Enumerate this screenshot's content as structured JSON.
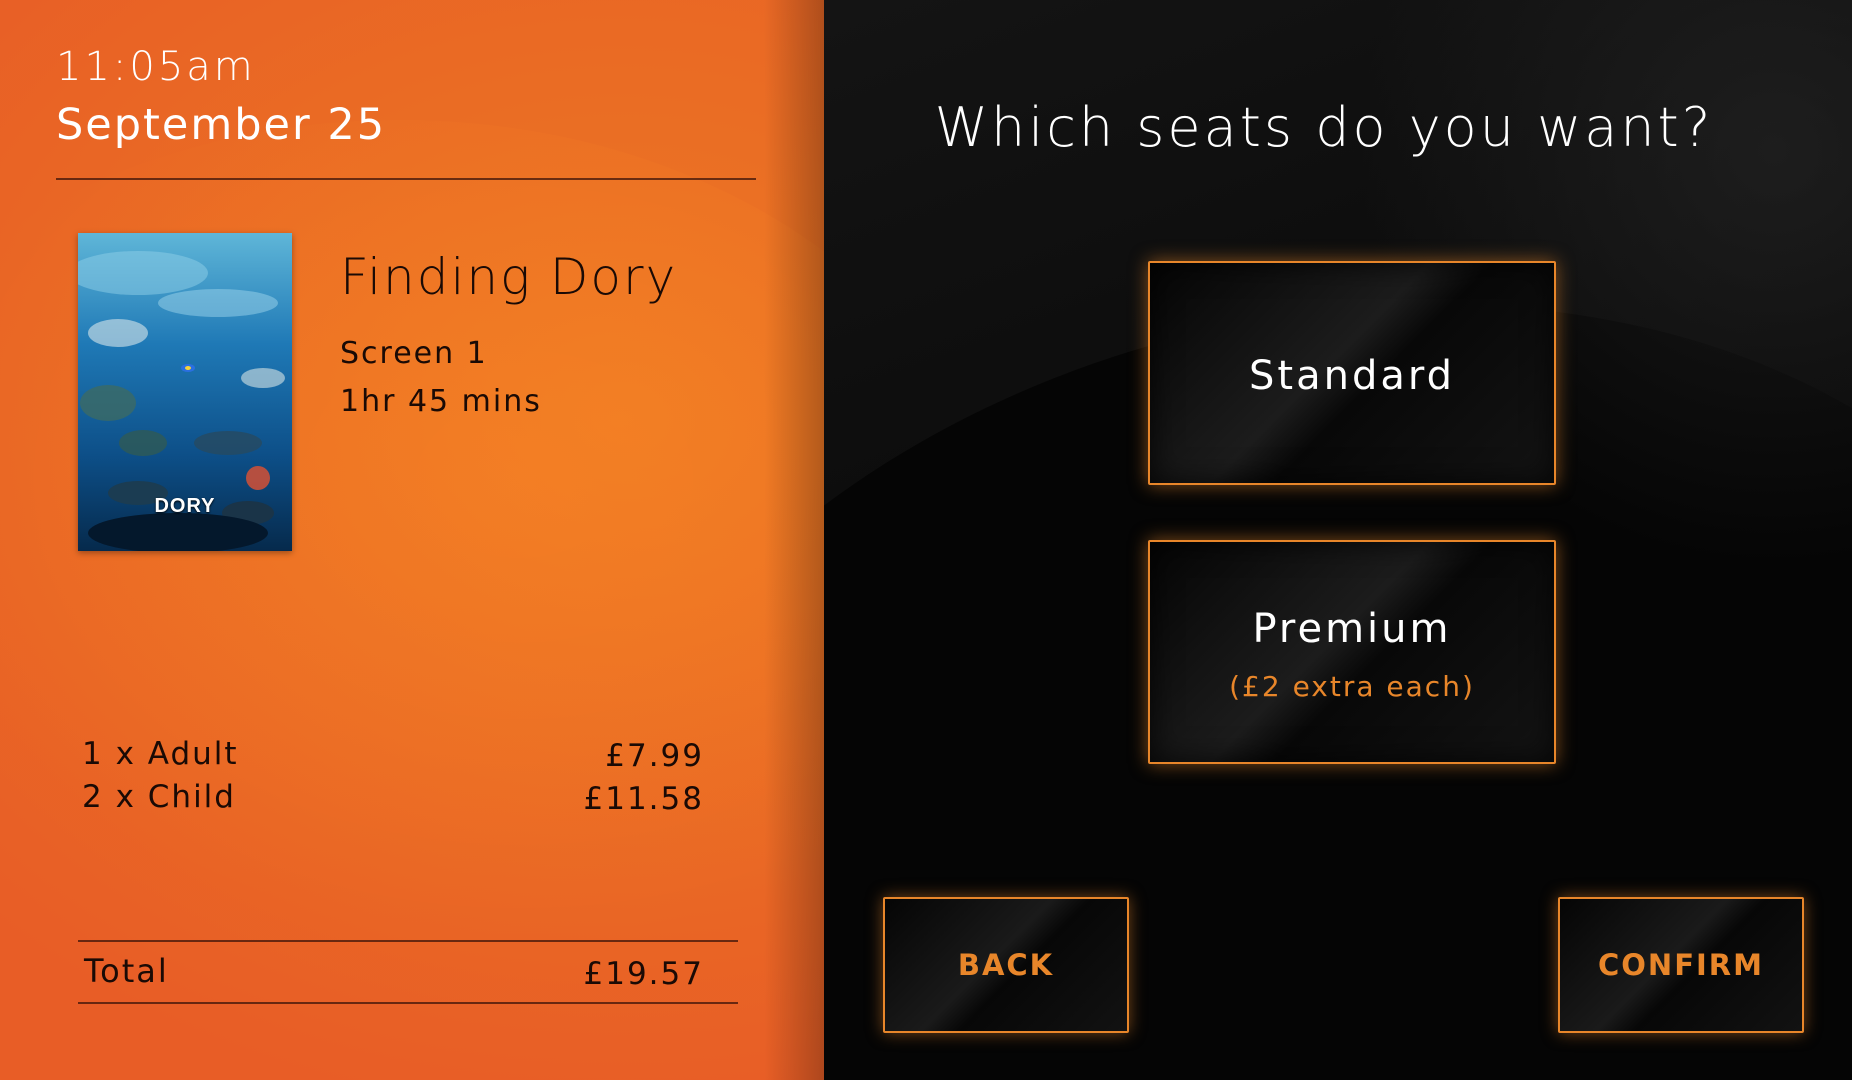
{
  "header": {
    "time": "11:05am",
    "date": "September 25"
  },
  "movie": {
    "poster_logo": "DORY",
    "title": "Finding Dory",
    "screen": "Screen 1",
    "duration": "1hr 45 mins"
  },
  "order": {
    "lines": [
      {
        "label": "1 x Adult",
        "price": "£7.99"
      },
      {
        "label": "2 x Child",
        "price": "£11.58"
      }
    ],
    "total_label": "Total",
    "total_price": "£19.57"
  },
  "seat_selection": {
    "question": "Which seats do you want?",
    "options": [
      {
        "label": "Standard",
        "note": ""
      },
      {
        "label": "Premium",
        "note": "(£2 extra each)"
      }
    ]
  },
  "navigation": {
    "back_label": "BACK",
    "confirm_label": "CONFIRM"
  },
  "colors": {
    "left_panel": "#ea6d24",
    "right_panel": "#0a0a0a",
    "accent": "#e8862a"
  }
}
